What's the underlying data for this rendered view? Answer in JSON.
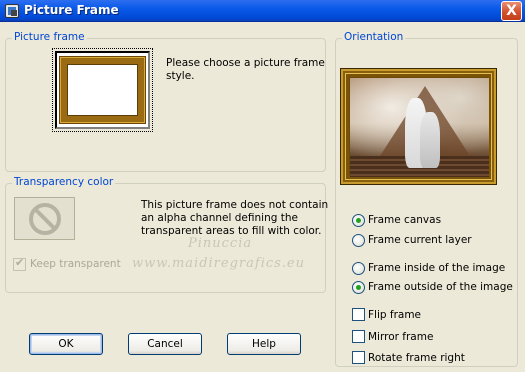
{
  "window": {
    "title": "Picture Frame",
    "close_glyph": "X",
    "icon": "app-icon"
  },
  "picture_frame_group": {
    "legend": "Picture frame",
    "instruction_line1": "Please choose a picture frame",
    "instruction_line2": "style."
  },
  "transparency_group": {
    "legend": "Transparency color",
    "message_line1": "This picture frame does not contain",
    "message_line2": "an alpha channel defining the",
    "message_line3": "transparent areas to fill with color.",
    "keep_transparent_label": "Keep transparent",
    "keep_transparent_checked": true,
    "keep_transparent_enabled": false
  },
  "orientation_group": {
    "legend": "Orientation",
    "frame_canvas_label": "Frame canvas",
    "frame_current_layer_label": "Frame current layer",
    "frame_target_selected": "Frame canvas",
    "frame_inside_label": "Frame inside of the image",
    "frame_outside_label": "Frame outside of the image",
    "frame_position_selected": "Frame outside of the image",
    "flip_frame_label": "Flip frame",
    "flip_frame_checked": false,
    "mirror_frame_label": "Mirror frame",
    "mirror_frame_checked": false,
    "rotate_frame_right_label": "Rotate frame right",
    "rotate_frame_right_checked": false
  },
  "buttons": {
    "ok_label": "OK",
    "cancel_label": "Cancel",
    "help_label": "Help"
  },
  "watermark": {
    "line1": "Pinuccia",
    "line2": "www.maidiregrafics.eu"
  },
  "colors": {
    "titlebar": "#0a5ae8",
    "group_legend": "#0046d5",
    "dialog_bg": "#ece9d8",
    "frame_gold": "#9a6b12"
  }
}
